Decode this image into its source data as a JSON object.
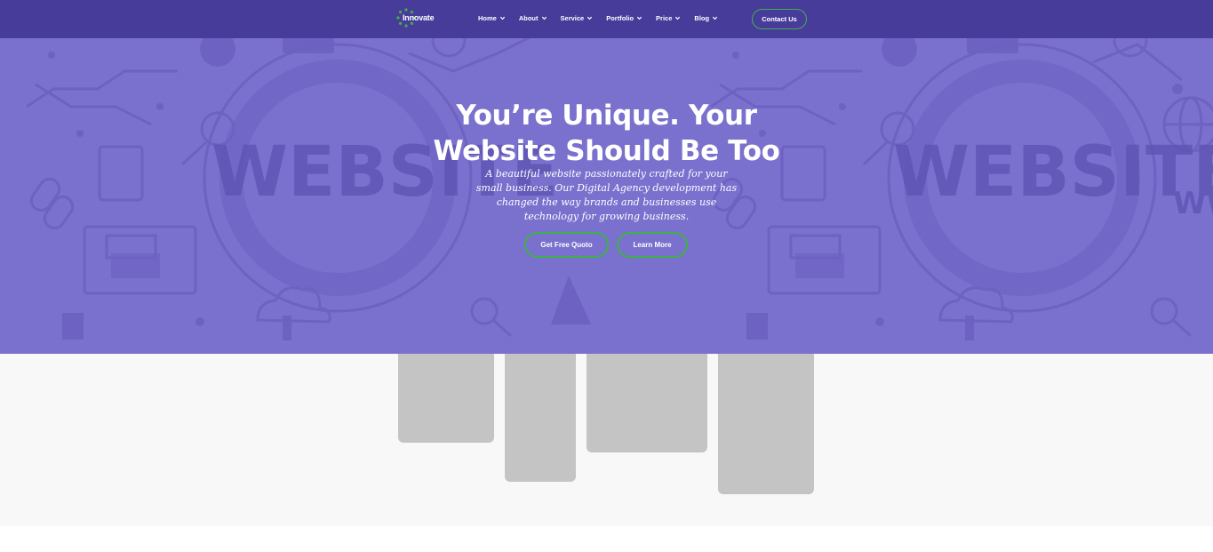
{
  "nav": {
    "logo_text": "Innovate",
    "items": [
      {
        "label": "Home"
      },
      {
        "label": "About"
      },
      {
        "label": "Service"
      },
      {
        "label": "Portfolio"
      },
      {
        "label": "Price"
      },
      {
        "label": "Blog"
      }
    ],
    "contact_label": "Contact Us"
  },
  "hero": {
    "title_line1": "You’re Unique. Your",
    "title_line2": "Website Should Be Too",
    "subtitle": "A beautiful website passionately crafted for your small business. Our Digital Agency development has changed the way brands and businesses use technology for growing business.",
    "buttons": {
      "quote": "Get Free Quoto",
      "more": "Learn More"
    },
    "background_words": [
      "WEBSITE",
      "WEBSITE",
      "WW"
    ]
  },
  "colors": {
    "nav_bg": "#483c9b",
    "hero_bg": "#7a70cd",
    "accent_green": "#3fb04a",
    "placeholder_gray": "#c4c4c4",
    "section_bg": "#f8f8f9"
  },
  "icons": [
    "chevron-down-icon",
    "logo-dots-icon"
  ]
}
